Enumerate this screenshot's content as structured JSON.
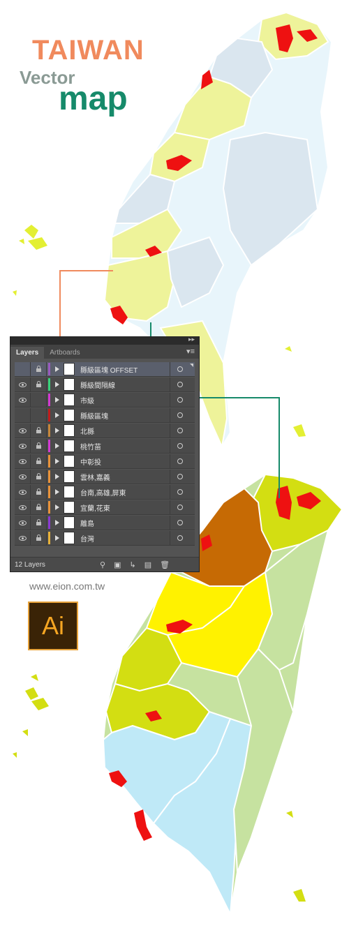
{
  "title": {
    "line1": "TAIWAN",
    "line2": "Vector",
    "line3": "map"
  },
  "website": "www.eion.com.tw",
  "ai_logo_text": "Ai",
  "colors": {
    "accent_title": "#f08a5d",
    "accent_map": "#168a6a",
    "connector_orange": "#f08a5d",
    "connector_green": "#168a6a"
  },
  "layers_panel": {
    "tabs": [
      "Layers",
      "Artboards"
    ],
    "footer_count": "12 Layers",
    "layers": [
      {
        "name": "縣級區塊 OFFSET",
        "visible": false,
        "locked": true,
        "color": "#9a5bc0",
        "selected": true
      },
      {
        "name": "縣級間隔線",
        "visible": true,
        "locked": true,
        "color": "#39d27a",
        "selected": false
      },
      {
        "name": "市級",
        "visible": true,
        "locked": false,
        "color": "#d23ad2",
        "selected": false
      },
      {
        "name": "縣級區塊",
        "visible": false,
        "locked": false,
        "color": "#c21c1c",
        "selected": false
      },
      {
        "name": "北縣",
        "visible": true,
        "locked": true,
        "color": "#c7873a",
        "selected": false
      },
      {
        "name": "桃竹苗",
        "visible": true,
        "locked": true,
        "color": "#d23ad2",
        "selected": false
      },
      {
        "name": "中彰投",
        "visible": true,
        "locked": true,
        "color": "#e8923a",
        "selected": false
      },
      {
        "name": "雲林,嘉義",
        "visible": true,
        "locked": true,
        "color": "#e8923a",
        "selected": false
      },
      {
        "name": "台南,高雄,屏東",
        "visible": true,
        "locked": true,
        "color": "#e8923a",
        "selected": false
      },
      {
        "name": "宜蘭,花東",
        "visible": true,
        "locked": true,
        "color": "#e8923a",
        "selected": false
      },
      {
        "name": "離島",
        "visible": true,
        "locked": true,
        "color": "#8a3ad2",
        "selected": false
      },
      {
        "name": "台灣",
        "visible": true,
        "locked": true,
        "color": "#e8b23a",
        "selected": false
      }
    ]
  }
}
